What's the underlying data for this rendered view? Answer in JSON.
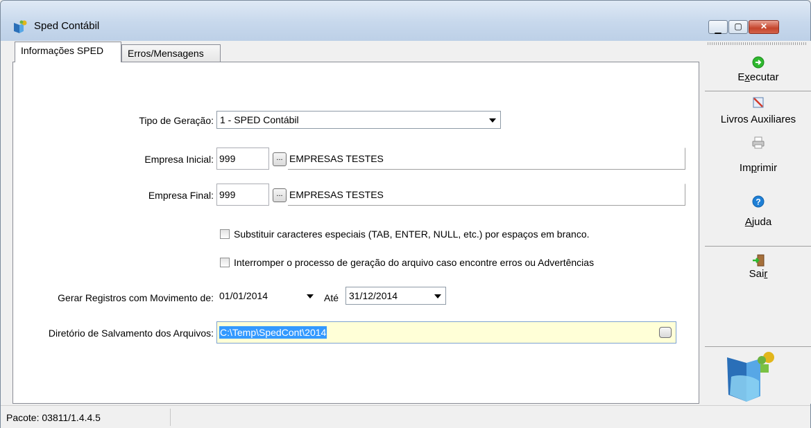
{
  "window": {
    "title": "Sped Contábil",
    "icon": "app-logo-icon",
    "buttons": [
      "minimize",
      "maximize",
      "close"
    ]
  },
  "tabs": [
    {
      "label": "Informações SPED",
      "active": true
    },
    {
      "label": "Erros/Mensagens",
      "active": false
    }
  ],
  "form": {
    "tipo_geracao_label": "Tipo de Geração:",
    "tipo_geracao_value": "1 - SPED Contábil",
    "empresa_inicial_label": "Empresa Inicial:",
    "empresa_inicial_value": "999",
    "empresa_inicial_desc": "EMPRESAS TESTES",
    "empresa_final_label": "Empresa Final:",
    "empresa_final_value": "999",
    "empresa_final_desc": "EMPRESAS TESTES",
    "ellipsis": "...",
    "chk_substituir_label": "Substituir caracteres especiais (TAB, ENTER, NULL, etc.) por espaços em branco.",
    "chk_substituir_checked": false,
    "chk_interromper_label": "Interromper o processo de geração do arquivo caso encontre erros ou Advertências",
    "chk_interromper_checked": false,
    "movimento_label": "Gerar Registros com Movimento de:",
    "data_inicio": "01/01/2014",
    "ate_label": "Até",
    "data_fim": "31/12/2014",
    "diretorio_label": "Diretório de Salvamento dos Arquivos:",
    "diretorio_value": "C:\\Temp\\SpedCont\\2014"
  },
  "toolbar": {
    "executar_pre": "E",
    "executar_ul": "x",
    "executar_post": "ecutar",
    "livros": "Livros Auxiliares",
    "imprimir_pre": "Im",
    "imprimir_ul": "p",
    "imprimir_post": "rimir",
    "ajuda_ul": "A",
    "ajuda_post": "juda",
    "sair_pre": "Sai",
    "sair_ul": "r",
    "icons": [
      "execute-icon",
      "books-icon",
      "printer-icon",
      "help-icon",
      "exit-icon"
    ]
  },
  "status": {
    "pacote": "Pacote: 03811/1.4.4.5"
  },
  "colors": {
    "directory_bg": "#ffffd7",
    "selection": "#3399ff",
    "execute_green": "#2eb82e",
    "help_blue": "#1e7fd6"
  }
}
